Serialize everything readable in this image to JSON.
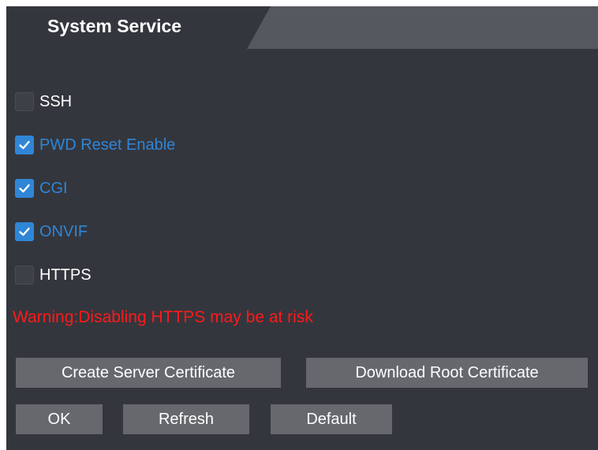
{
  "tab": {
    "title": "System Service"
  },
  "options": [
    {
      "label": "SSH",
      "checked": false
    },
    {
      "label": "PWD Reset Enable",
      "checked": true
    },
    {
      "label": "CGI",
      "checked": true
    },
    {
      "label": "ONVIF",
      "checked": true
    },
    {
      "label": "HTTPS",
      "checked": false
    }
  ],
  "warning": "Warning:Disabling HTTPS may be at risk",
  "buttons": {
    "create_cert": "Create Server Certificate",
    "download_root_cert": "Download Root Certificate",
    "ok": "OK",
    "refresh": "Refresh",
    "default": "Default"
  },
  "colors": {
    "background": "#34363d",
    "tab_inactive": "#56585f",
    "checked_accent": "#2f86d6",
    "warning": "#ff1a1a",
    "button": "#66686e"
  }
}
